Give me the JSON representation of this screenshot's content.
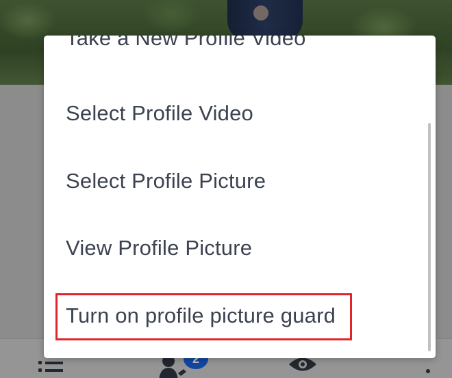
{
  "menu": {
    "items": [
      {
        "label": "Take a New Profile Video"
      },
      {
        "label": "Select Profile Video"
      },
      {
        "label": "Select Profile Picture"
      },
      {
        "label": "View Profile Picture"
      },
      {
        "label": "Turn on profile picture guard"
      }
    ],
    "highlighted_item": "Turn on profile picture guard",
    "highlight_color": "#e0242b"
  },
  "bottom_nav": {
    "icons": [
      "menu-list-icon",
      "friends-icon",
      "eye-icon",
      "more-icon"
    ],
    "friends_badge": "2",
    "badge_color": "#1a61d9"
  }
}
